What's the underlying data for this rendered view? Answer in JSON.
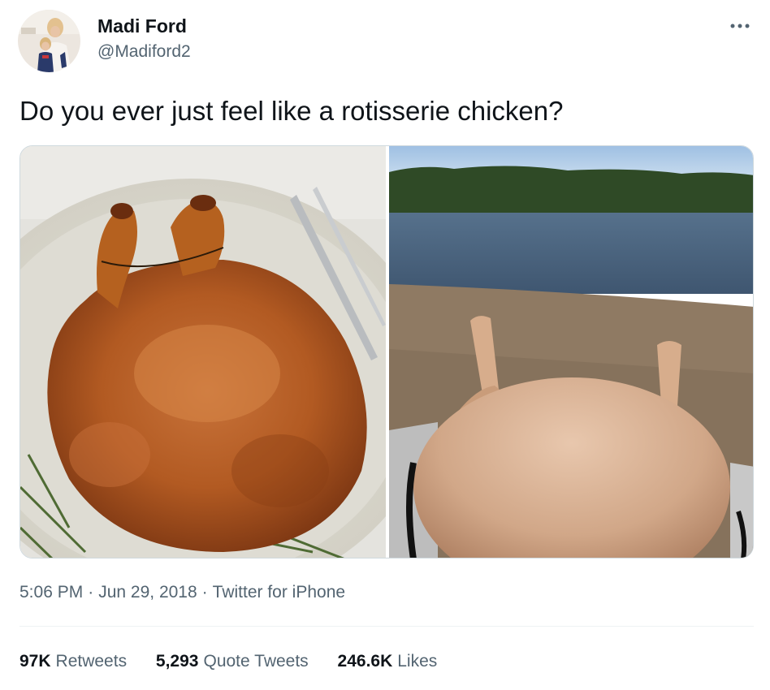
{
  "author": {
    "display_name": "Madi Ford",
    "handle": "@Madiford2",
    "avatar_icon": "avatar-photo"
  },
  "tweet": {
    "text": "Do you ever just feel like a rotisserie chicken?"
  },
  "media": [
    {
      "description_icon": "roast-chicken-photo"
    },
    {
      "description_icon": "beach-belly-photo"
    }
  ],
  "meta": {
    "time": "5:06 PM",
    "date": "Jun 29, 2018",
    "source": "Twitter for iPhone",
    "separator": "·"
  },
  "stats": {
    "retweets_count": "97K",
    "retweets_label": "Retweets",
    "quotes_count": "5,293",
    "quotes_label": "Quote Tweets",
    "likes_count": "246.6K",
    "likes_label": "Likes"
  },
  "colors": {
    "text_primary": "#0f1419",
    "text_secondary": "#536471",
    "border": "#cfd9de",
    "divider": "#eff3f4"
  }
}
